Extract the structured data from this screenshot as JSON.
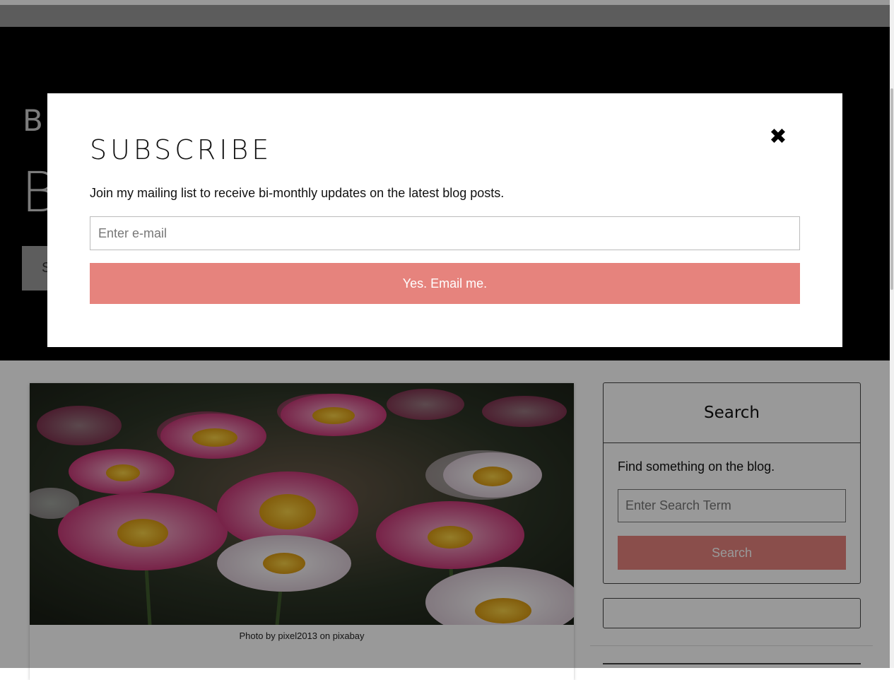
{
  "header": {
    "title_small": "B",
    "title_big": "B",
    "button_label": "S"
  },
  "post": {
    "image_caption": "Photo by pixel2013 on pixabay"
  },
  "sidebar": {
    "search_widget": {
      "title": "Search",
      "description": "Find something on the blog.",
      "input_placeholder": "Enter Search Term",
      "button_label": "Search"
    }
  },
  "modal": {
    "title": "SUBSCRIBE",
    "close_icon": "close-icon",
    "description": "Join my mailing list to receive bi-monthly updates on the latest blog posts.",
    "email_placeholder": "Enter e-mail",
    "submit_label": "Yes. Email me."
  },
  "colors": {
    "accent": "#e6837d",
    "hero_bg": "#000000",
    "overlay": "rgba(0,0,0,0.4)"
  }
}
